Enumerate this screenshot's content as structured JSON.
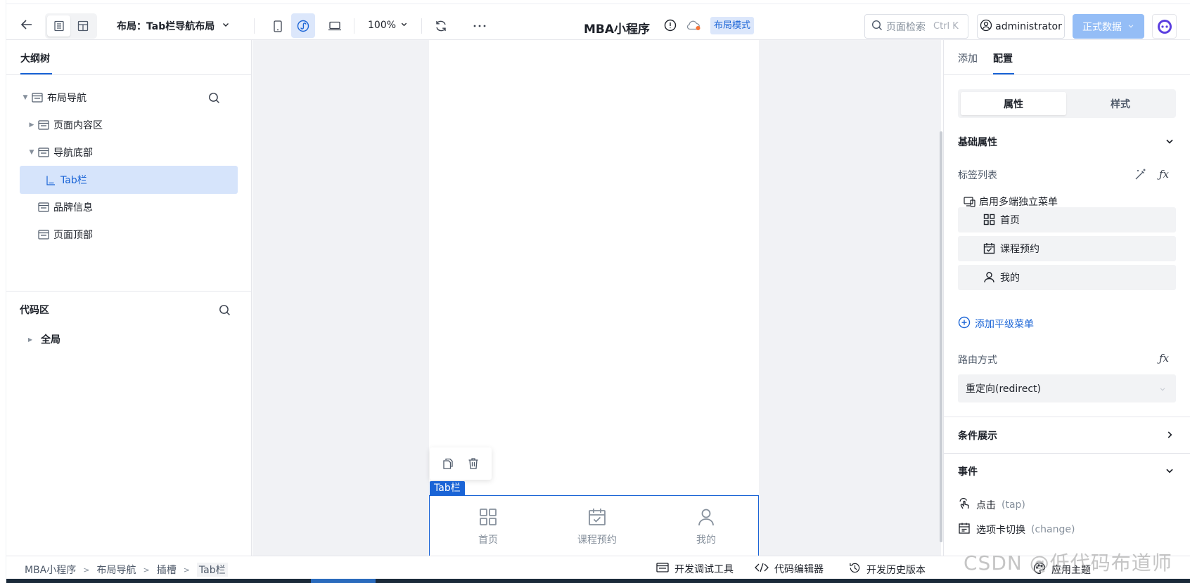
{
  "toolbar": {
    "layout_label": "布局：Tab栏导航布局",
    "zoom": "100%",
    "app_title": "MBA小程序",
    "mode_tag": "布局模式",
    "search_placeholder": "页面检索",
    "search_shortcut": "Ctrl K",
    "user": "administrator",
    "data_button": "正式数据"
  },
  "left_panel": {
    "tab": "大纲树",
    "tree": [
      {
        "label": "布局导航",
        "level": 0,
        "expanded": true
      },
      {
        "label": "页面内容区",
        "level": 1,
        "expanded": false
      },
      {
        "label": "导航底部",
        "level": 1,
        "expanded": true
      },
      {
        "label": "Tab栏",
        "level": 2,
        "selected": true
      },
      {
        "label": "品牌信息",
        "level": 1
      },
      {
        "label": "页面顶部",
        "level": 1
      }
    ],
    "code_section": "代码区",
    "code_tree": [
      {
        "label": "全局"
      }
    ]
  },
  "canvas": {
    "selected_label": "Tab栏",
    "tabbar_items": [
      {
        "label": "首页",
        "icon": "grid-icon"
      },
      {
        "label": "课程预约",
        "icon": "calendar-check-icon"
      },
      {
        "label": "我的",
        "icon": "user-icon"
      }
    ]
  },
  "right_panel": {
    "tabs": [
      "添加",
      "配置"
    ],
    "active_tab": "配置",
    "segments": [
      "属性",
      "样式"
    ],
    "active_segment": "属性",
    "basic_props": "基础属性",
    "tag_list_label": "标签列表",
    "multi_menu": "启用多端独立菜单",
    "menu_items": [
      {
        "label": "首页",
        "icon": "grid-icon"
      },
      {
        "label": "课程预约",
        "icon": "calendar-check-icon"
      },
      {
        "label": "我的",
        "icon": "user-icon"
      }
    ],
    "add_menu": "添加平级菜单",
    "route_label": "路由方式",
    "route_value": "重定向(redirect)",
    "cond_display": "条件展示",
    "events": "事件",
    "event_items": [
      {
        "label": "点击",
        "sub": "(tap)"
      },
      {
        "label": "选项卡切换",
        "sub": "(change)"
      }
    ]
  },
  "status_bar": {
    "breadcrumbs": [
      "MBA小程序",
      "布局导航",
      "插槽",
      "Tab栏"
    ],
    "debug": "开发调试工具",
    "code_editor": "代码编辑器",
    "history": "开发历史版本",
    "theme": "应用主题"
  },
  "watermark": "CSDN @低代码布道师"
}
